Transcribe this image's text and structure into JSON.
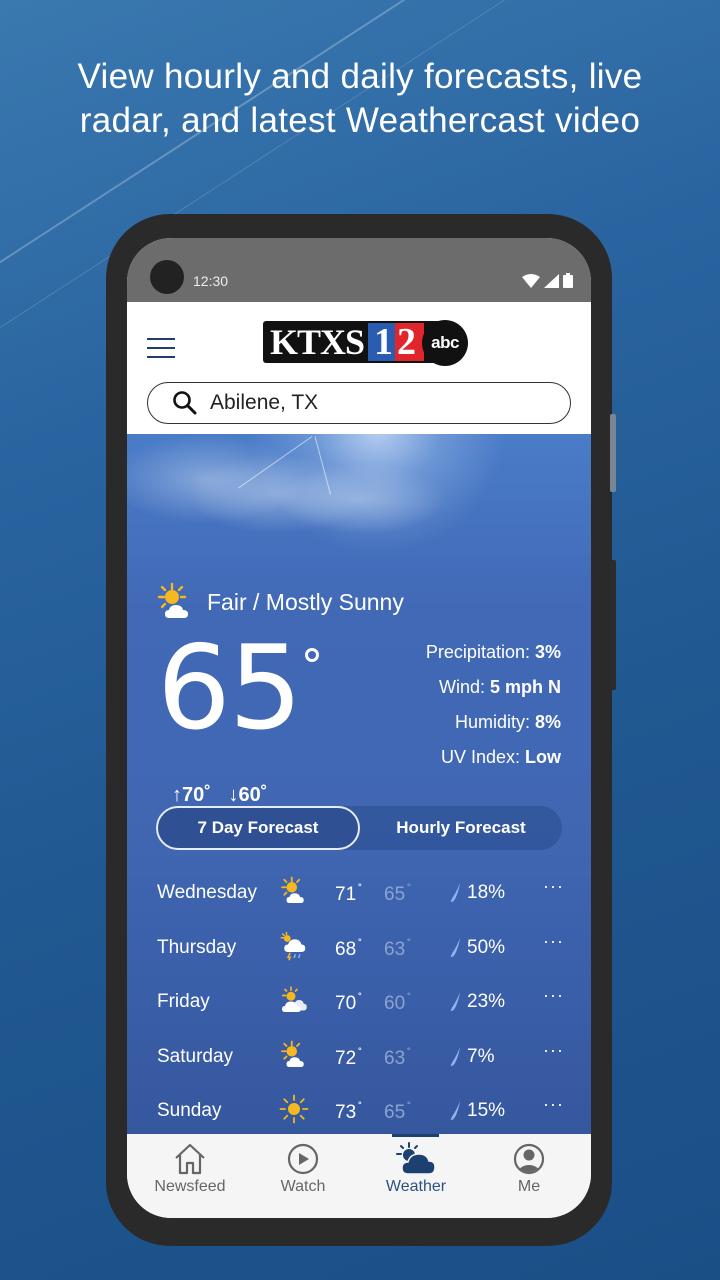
{
  "headline": {
    "line1": "View hourly and daily forecasts, live",
    "line2": "radar, and latest Weathercast video"
  },
  "status_bar": {
    "time": "12:30",
    "icons": [
      "wifi-icon",
      "signal-icon",
      "battery-icon"
    ]
  },
  "app_bar": {
    "menu_icon": "hamburger-menu-icon",
    "logo": {
      "call_sign": "KTXS",
      "channel_digit1": "1",
      "channel_digit2": "2",
      "network": "abc"
    },
    "search": {
      "icon": "search-icon",
      "value": "Abilene, TX"
    }
  },
  "current": {
    "condition_icon": "partly-sunny-icon",
    "condition": "Fair / Mostly Sunny",
    "temperature": "65",
    "high": "↑70˚",
    "low": "↓60˚",
    "stats": [
      {
        "label": "Precipitation: ",
        "value": "3%"
      },
      {
        "label": "Wind: ",
        "value": "5 mph N"
      },
      {
        "label": "Humidity: ",
        "value": "8%"
      },
      {
        "label": "UV Index: ",
        "value": "Low"
      }
    ]
  },
  "forecast_toggle": {
    "options": [
      "7 Day Forecast",
      "Hourly Forecast"
    ],
    "selected": "7 Day Forecast"
  },
  "daily": [
    {
      "day": "Wednesday",
      "icon": "partly-sunny-icon",
      "high": "71",
      "low": "65",
      "precip": "18%",
      "more": "···"
    },
    {
      "day": "Thursday",
      "icon": "sun-rain-cloud-icon",
      "high": "68",
      "low": "63",
      "precip": "50%",
      "more": "···"
    },
    {
      "day": "Friday",
      "icon": "mostly-cloudy-icon",
      "high": "70",
      "low": "60",
      "precip": "23%",
      "more": "···"
    },
    {
      "day": "Saturday",
      "icon": "partly-sunny-icon",
      "high": "72",
      "low": "63",
      "precip": "7%",
      "more": "···"
    },
    {
      "day": "Sunday",
      "icon": "sunny-icon",
      "high": "73",
      "low": "65",
      "precip": "15%",
      "more": "···"
    }
  ],
  "degree_symbol": "˚",
  "tabs": [
    {
      "label": "Newsfeed",
      "icon": "home-icon",
      "active": false
    },
    {
      "label": "Watch",
      "icon": "play-icon",
      "active": false
    },
    {
      "label": "Weather",
      "icon": "weather-icon",
      "active": true
    },
    {
      "label": "Me",
      "icon": "profile-icon",
      "active": false
    }
  ],
  "colors": {
    "accent": "#2c5283",
    "sun": "#f5b820",
    "precip_drop": "#8fb4ee",
    "low_temp": "#8aa4cf"
  }
}
